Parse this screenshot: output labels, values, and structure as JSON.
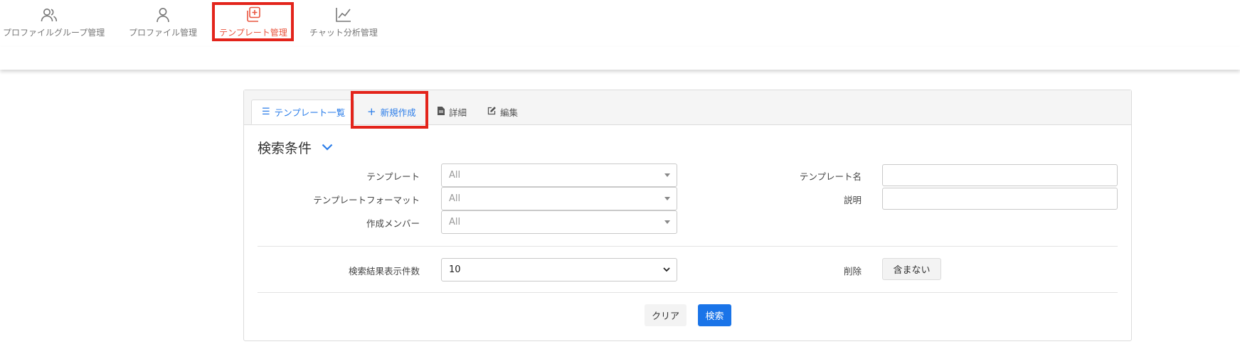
{
  "nav": {
    "items": [
      {
        "label": "プロファイルグループ管理",
        "icon": "users-icon"
      },
      {
        "label": "プロファイル管理",
        "icon": "user-icon"
      },
      {
        "label": "テンプレート管理",
        "icon": "template-add-icon",
        "active": true
      },
      {
        "label": "チャット分析管理",
        "icon": "line-chart-icon"
      }
    ]
  },
  "tabs": {
    "list": {
      "label": "テンプレート一覧",
      "icon": "list-icon"
    },
    "new": {
      "label": "新規作成",
      "icon": "plus-icon"
    },
    "detail": {
      "label": "詳細",
      "icon": "document-icon"
    },
    "edit": {
      "label": "編集",
      "icon": "edit-icon"
    }
  },
  "search": {
    "title": "検索条件",
    "template_label": "テンプレート",
    "template_value": "All",
    "format_label": "テンプレートフォーマット",
    "format_value": "All",
    "member_label": "作成メンバー",
    "member_value": "All",
    "name_label": "テンプレート名",
    "name_value": "",
    "desc_label": "説明",
    "desc_value": "",
    "count_label": "検索結果表示件数",
    "count_value": "10",
    "delete_label": "削除",
    "delete_value": "含まない",
    "clear_button": "クリア",
    "search_button": "検索"
  },
  "colors": {
    "accent": "#2b7de9",
    "active_nav": "#e9553f",
    "highlight_box": "#e3241b",
    "primary_button": "#1a74e8"
  }
}
